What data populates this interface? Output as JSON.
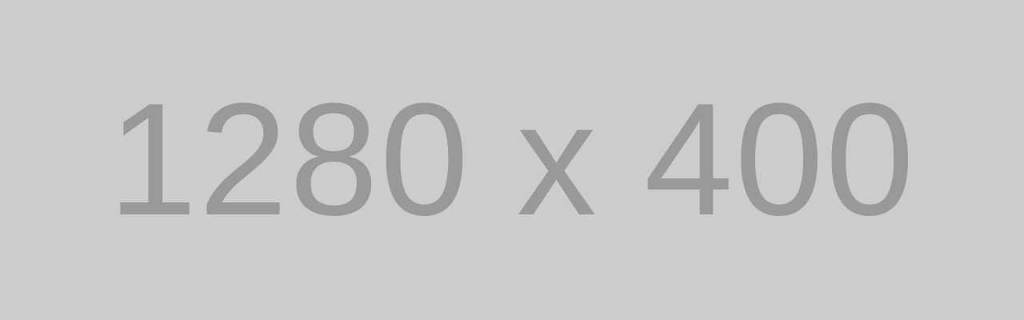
{
  "placeholder": {
    "label": "1280 x 400",
    "background_color": "#cccccc",
    "text_color": "#999999"
  }
}
